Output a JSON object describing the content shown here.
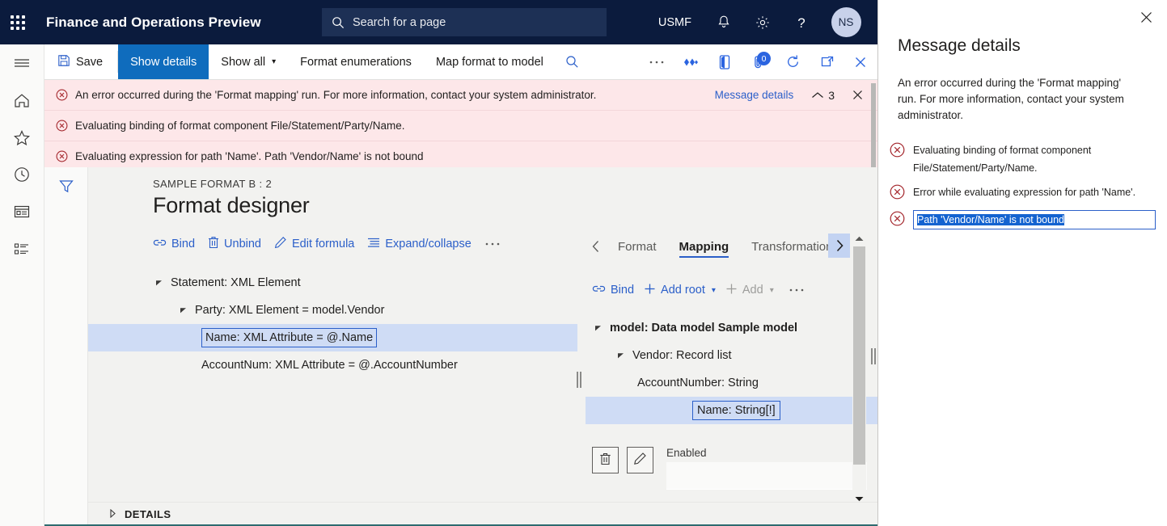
{
  "topbar": {
    "waffle_icon": "waffle-grid-icon",
    "app_title": "Finance and Operations Preview",
    "search": {
      "icon": "search-icon",
      "placeholder": "Search for a page",
      "value": ""
    },
    "company": "USMF",
    "notifications_icon": "bell-icon",
    "settings_icon": "gear-icon",
    "help_icon": "question-mark-icon",
    "avatar_initials": "NS",
    "bg_color": "#0b1b3d"
  },
  "commandbar": {
    "save_label": "Save",
    "save_icon": "save-disk-icon",
    "buttons": [
      {
        "label": "Show details",
        "active": true
      },
      {
        "label": "Show all",
        "has_chevron": true,
        "active": false
      },
      {
        "label": "Format enumerations",
        "active": false
      },
      {
        "label": "Map format to model",
        "active": false
      }
    ],
    "right_icons": [
      {
        "name": "search-icon"
      },
      {
        "name": "overflow-ellipsis-icon"
      },
      {
        "name": "share-diamond-icon"
      },
      {
        "name": "office-app-icon"
      },
      {
        "name": "attachment-icon",
        "badge": "0"
      },
      {
        "name": "refresh-icon"
      },
      {
        "name": "popout-icon"
      },
      {
        "name": "close-icon"
      }
    ]
  },
  "rail": {
    "items": [
      {
        "name": "hamburger-menu-icon"
      },
      {
        "name": "home-icon"
      },
      {
        "name": "favorites-star-icon"
      },
      {
        "name": "recent-clock-icon"
      },
      {
        "name": "workspaces-icon"
      },
      {
        "name": "modules-list-icon"
      }
    ]
  },
  "messagebar": {
    "bg_color": "#fde7e9",
    "messages": [
      "An error occurred during the 'Format mapping' run. For more information, contact your system administrator.",
      "Evaluating binding of format component File/Statement/Party/Name.",
      "Evaluating expression for path 'Name'.   Path 'Vendor/Name' is not bound"
    ],
    "details_link": "Message details",
    "collapse_count": "3",
    "collapse_icon": "chevron-up-icon",
    "close_icon": "close-icon"
  },
  "page": {
    "filter_icon": "filter-funnel-icon",
    "breadcrumb": "SAMPLE FORMAT B : 2",
    "title": "Format designer"
  },
  "format_pane": {
    "toolbar": [
      {
        "label": "Bind",
        "icon": "bind-link-icon",
        "disabled": false
      },
      {
        "label": "Unbind",
        "icon": "trash-icon",
        "disabled": false
      },
      {
        "label": "Edit formula",
        "icon": "pencil-icon",
        "disabled": false
      },
      {
        "label": "Expand/collapse",
        "icon": "list-lines-icon",
        "disabled": false
      },
      {
        "label": "···",
        "icon": "overflow-ellipsis-icon",
        "disabled": false
      }
    ],
    "tree": [
      {
        "label": "Statement: XML Element",
        "level": 1,
        "expander": "expanded",
        "selected": false
      },
      {
        "label": "Party: XML Element = model.Vendor",
        "level": 2,
        "expander": "expanded",
        "selected": false
      },
      {
        "label": "Name: XML Attribute = @.Name",
        "level": 3,
        "expander": "none",
        "selected": true
      },
      {
        "label": "AccountNum: XML Attribute = @.AccountNumber",
        "level": 3,
        "expander": "none",
        "selected": false
      }
    ]
  },
  "mapping_pane": {
    "tabs": [
      {
        "label": "Format",
        "active": false
      },
      {
        "label": "Mapping",
        "active": true
      },
      {
        "label": "Transformations",
        "active": false
      }
    ],
    "prev_icon": "chevron-left-icon",
    "next_icon": "chevron-right-icon",
    "toolbar": [
      {
        "label": "Bind",
        "icon": "bind-link-icon",
        "disabled": false
      },
      {
        "label": "Add root",
        "icon": "plus-icon",
        "chevron": true,
        "disabled": false
      },
      {
        "label": "Add",
        "icon": "plus-icon",
        "chevron": true,
        "disabled": true
      },
      {
        "label": "···",
        "icon": "overflow-ellipsis-icon",
        "disabled": false
      }
    ],
    "tree": [
      {
        "label": "model: Data model Sample model",
        "level": 1,
        "expander": "expanded",
        "bold": true,
        "selected": false
      },
      {
        "label": "Vendor: Record list",
        "level": 2,
        "expander": "expanded",
        "bold": false,
        "selected": false
      },
      {
        "label": "AccountNumber: String",
        "level": 3,
        "expander": "none",
        "bold": false,
        "selected": false
      },
      {
        "label": "Name: String[!]",
        "level": 3,
        "expander": "none",
        "bold": false,
        "selected": true
      }
    ],
    "actions": [
      {
        "name": "delete-button",
        "icon": "trash-icon"
      },
      {
        "name": "edit-button",
        "icon": "pencil-icon"
      }
    ],
    "field": {
      "label": "Enabled",
      "value": ""
    },
    "scrollbar": {
      "up_icon": "scroll-up-arrow-icon",
      "down_icon": "scroll-down-arrow-icon"
    }
  },
  "details_section": {
    "label": "DETAILS",
    "expander_icon": "chevron-right-icon"
  },
  "side_panel": {
    "close_icon": "close-icon",
    "title": "Message details",
    "body": "An error occurred during the 'Format mapping' run. For more information, contact your system administrator.",
    "items": [
      {
        "text": "Evaluating binding of format component File/Statement/Party/Name.",
        "icon": "error-circle-icon",
        "selected": false
      },
      {
        "text": "Error while evaluating expression for path 'Name'.",
        "icon": "error-circle-icon",
        "selected": false
      },
      {
        "text": "Path 'Vendor/Name' is not bound",
        "icon": "error-circle-icon",
        "selected": true
      }
    ]
  },
  "colors": {
    "nav_bg": "#0b1b3d",
    "accent": "#0f6cbd",
    "link": "#2b5fc9",
    "error_bg": "#fde7e9",
    "error_red": "#a4262c",
    "selection_blue": "#cfdcf5"
  }
}
